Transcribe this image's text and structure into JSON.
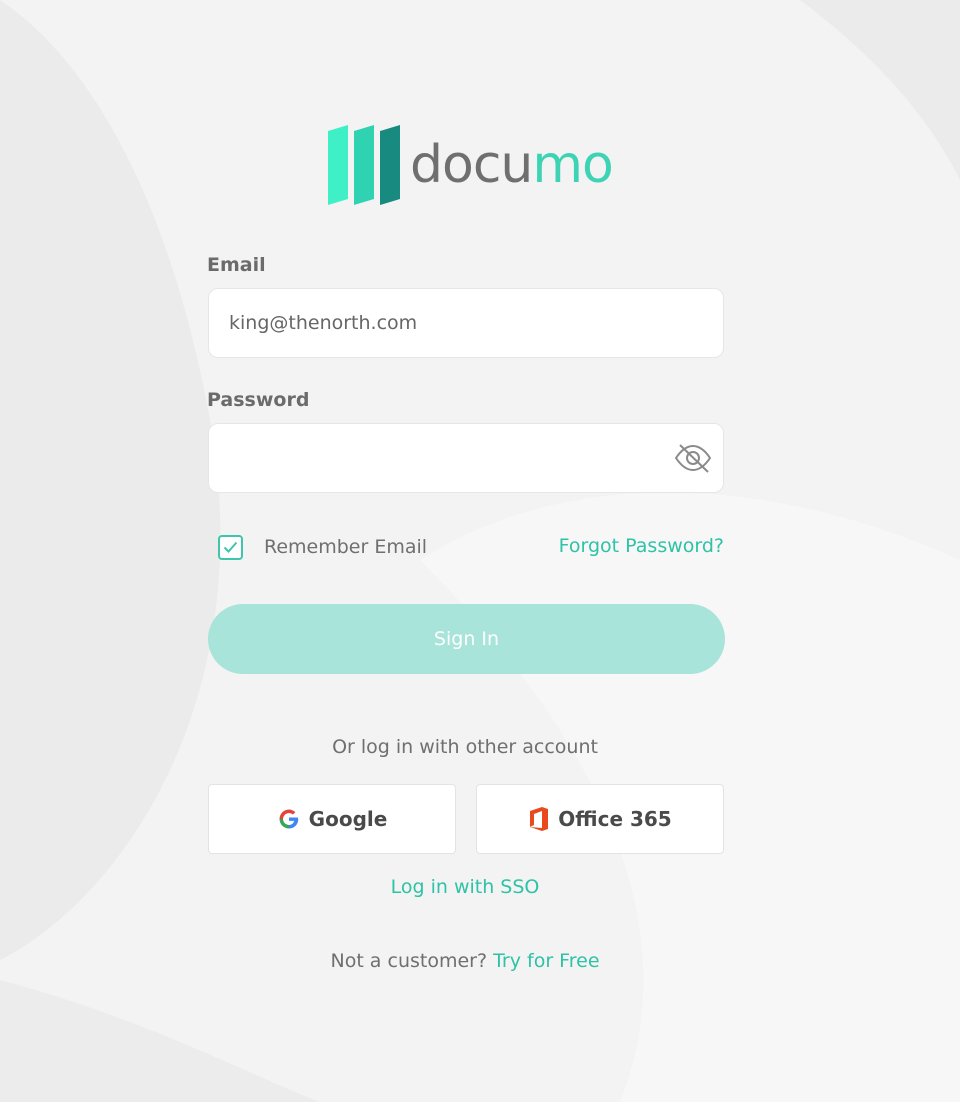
{
  "brand": {
    "wordmark_prefix": "docu",
    "wordmark_accent": "mo",
    "logo_icon": "stripes-logo-icon",
    "accent_color": "#3fd3b6",
    "link_color": "#2ec2a6"
  },
  "form": {
    "email_label": "Email",
    "email_value": "king@thenorth.com",
    "password_label": "Password",
    "password_value": "",
    "password_toggle_icon": "eye-slash-icon",
    "remember_label": "Remember Email",
    "remember_checked": true,
    "forgot_label": "Forgot Password?",
    "signin_label": "Sign In"
  },
  "alt_login": {
    "divider_text": "Or log in with other account",
    "google_label": "Google",
    "google_icon": "google-icon",
    "office_label": "Office 365",
    "office_icon": "office-365-icon",
    "sso_label": "Log in with SSO"
  },
  "footer": {
    "prompt": "Not a customer?",
    "trial_link": "Try for Free"
  }
}
